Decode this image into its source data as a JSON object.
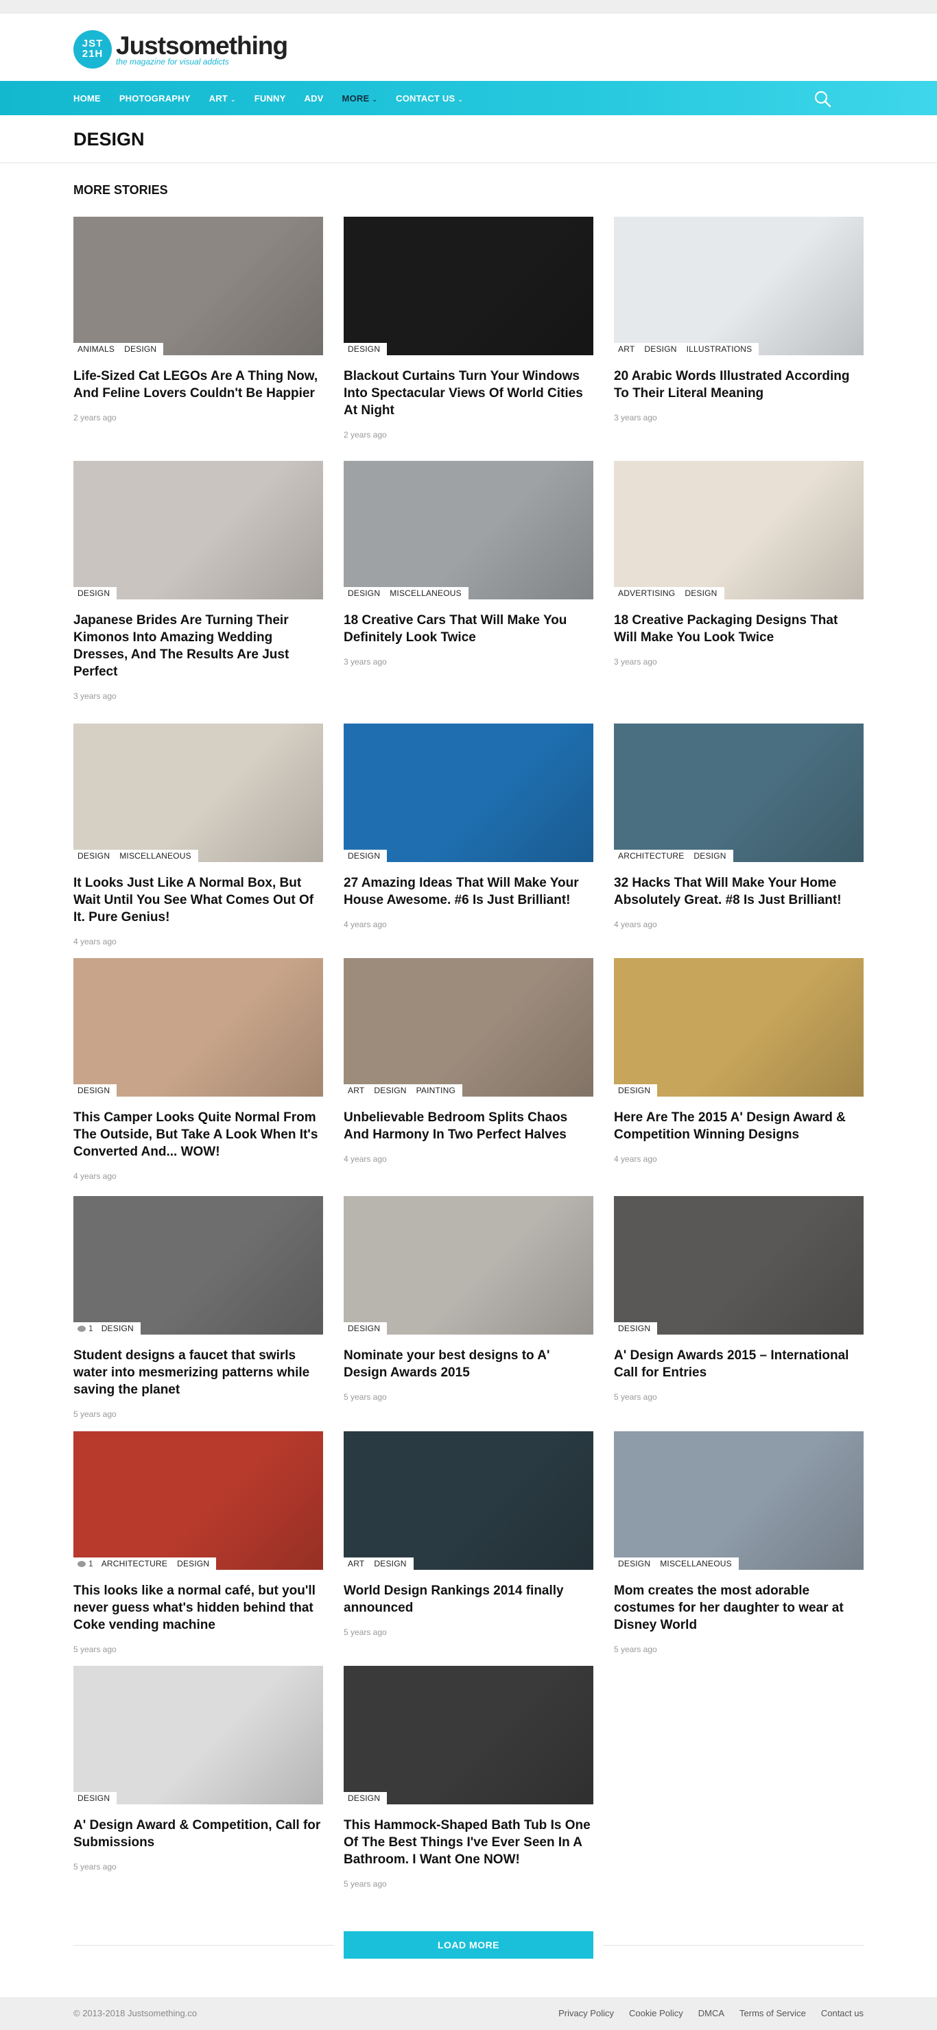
{
  "brand": {
    "mark": "JST 21H",
    "name": "Justsomething",
    "tagline": "the magazine for visual addicts"
  },
  "nav": [
    {
      "label": "HOME",
      "caret": false
    },
    {
      "label": "PHOTOGRAPHY",
      "caret": false
    },
    {
      "label": "ART",
      "caret": true
    },
    {
      "label": "FUNNY",
      "caret": false
    },
    {
      "label": "ADV",
      "caret": false
    },
    {
      "label": "MORE",
      "caret": true,
      "active": true
    },
    {
      "label": "CONTACT US",
      "caret": true
    }
  ],
  "page": {
    "title": "DESIGN",
    "section": "MORE STORIES"
  },
  "stories": [
    {
      "tags": [
        "ANIMALS",
        "DESIGN"
      ],
      "title": "Life-Sized Cat LEGOs Are A Thing Now, And Feline Lovers Couldn't Be Happier",
      "date": "2 years ago",
      "comments": null
    },
    {
      "tags": [
        "DESIGN"
      ],
      "title": "Blackout Curtains Turn Your Windows Into Spectacular Views Of World Cities At Night",
      "date": "2 years ago",
      "comments": null
    },
    {
      "tags": [
        "ART",
        "DESIGN",
        "ILLUSTRATIONS"
      ],
      "title": "20 Arabic Words Illustrated According To Their Literal Meaning",
      "date": "3 years ago",
      "comments": null
    },
    {
      "tags": [
        "DESIGN"
      ],
      "title": "Japanese Brides Are Turning Their Kimonos Into Amazing Wedding Dresses, And The Results Are Just Perfect",
      "date": "3 years ago",
      "comments": null
    },
    {
      "tags": [
        "DESIGN",
        "MISCELLANEOUS"
      ],
      "title": "18 Creative Cars That Will Make You Definitely Look Twice",
      "date": "3 years ago",
      "comments": null
    },
    {
      "tags": [
        "ADVERTISING",
        "DESIGN"
      ],
      "title": "18 Creative Packaging Designs That Will Make You Look Twice",
      "date": "3 years ago",
      "comments": null
    },
    {
      "tags": [
        "DESIGN",
        "MISCELLANEOUS"
      ],
      "title": "It Looks Just Like A Normal Box, But Wait Until You See What Comes Out Of It. Pure Genius!",
      "date": "4 years ago",
      "comments": null
    },
    {
      "tags": [
        "DESIGN"
      ],
      "title": "27 Amazing Ideas That Will Make Your House Awesome. #6 Is Just Brilliant!",
      "date": "4 years ago",
      "comments": null
    },
    {
      "tags": [
        "ARCHITECTURE",
        "DESIGN"
      ],
      "title": "32 Hacks That Will Make Your Home Absolutely Great. #8 Is Just Brilliant!",
      "date": "4 years ago",
      "comments": null
    },
    {
      "tags": [
        "DESIGN"
      ],
      "title": "This Camper Looks Quite Normal From The Outside, But Take A Look When It's Converted And... WOW!",
      "date": "4 years ago",
      "comments": null
    },
    {
      "tags": [
        "ART",
        "DESIGN",
        "PAINTING"
      ],
      "title": "Unbelievable Bedroom Splits Chaos And Harmony In Two Perfect Halves",
      "date": "4 years ago",
      "comments": null
    },
    {
      "tags": [
        "DESIGN"
      ],
      "title": "Here Are The 2015 A' Design Award & Competition Winning Designs",
      "date": "4 years ago",
      "comments": null
    },
    {
      "tags": [
        "DESIGN"
      ],
      "title": "Student designs a faucet that swirls water into mesmerizing patterns while saving the planet",
      "date": "5 years ago",
      "comments": "1"
    },
    {
      "tags": [
        "DESIGN"
      ],
      "title": "Nominate your best designs to A' Design Awards 2015",
      "date": "5 years ago",
      "comments": null
    },
    {
      "tags": [
        "DESIGN"
      ],
      "title": "A' Design Awards 2015 – International Call for Entries",
      "date": "5 years ago",
      "comments": null
    },
    {
      "tags": [
        "ARCHITECTURE",
        "DESIGN"
      ],
      "title": "This looks like a normal café, but you'll never guess what's hidden behind that Coke vending machine",
      "date": "5 years ago",
      "comments": "1"
    },
    {
      "tags": [
        "ART",
        "DESIGN"
      ],
      "title": "World Design Rankings 2014 finally announced",
      "date": "5 years ago",
      "comments": null
    },
    {
      "tags": [
        "DESIGN",
        "MISCELLANEOUS"
      ],
      "title": "Mom creates the most adorable costumes for her daughter to wear at Disney World",
      "date": "5 years ago",
      "comments": null
    },
    {
      "tags": [
        "DESIGN"
      ],
      "title": "A' Design Award & Competition, Call for Submissions",
      "date": "5 years ago",
      "comments": null
    },
    {
      "tags": [
        "DESIGN"
      ],
      "title": "This Hammock-Shaped Bath Tub Is One Of The Best Things I've Ever Seen In A Bathroom. I Want One NOW!",
      "date": "5 years ago",
      "comments": null
    }
  ],
  "images": {
    "story-01": "#8c8782",
    "story-02": "#1a1a1a",
    "story-03": "#e6e9ec",
    "story-04": "#c9c4bf",
    "story-05": "#9ea2a5",
    "story-06": "#e8e0d4",
    "story-07": "#d6cfc4",
    "story-08": "#1f6fb0",
    "story-09": "#4a6f80",
    "story-10": "#c8a58a",
    "story-11": "#9d8c7c",
    "story-12": "#c7a55a",
    "story-13": "#6e6e6e",
    "story-14": "#b8b4ae",
    "story-15": "#5a5856",
    "story-16": "#b73a2c",
    "story-17": "#2a3a42",
    "story-18": "#8e9ba8",
    "story-19": "#dcdcdc",
    "story-20": "#3a3a3a"
  },
  "load_more": "LOAD MORE",
  "footer": {
    "copyright": "© 2013-2018 Justsomething.co",
    "links": [
      "Privacy Policy",
      "Cookie Policy",
      "DMCA",
      "Terms of Service",
      "Contact us"
    ]
  },
  "colors": {
    "accent": "#1ac0d9",
    "nav_active": "#103040"
  }
}
